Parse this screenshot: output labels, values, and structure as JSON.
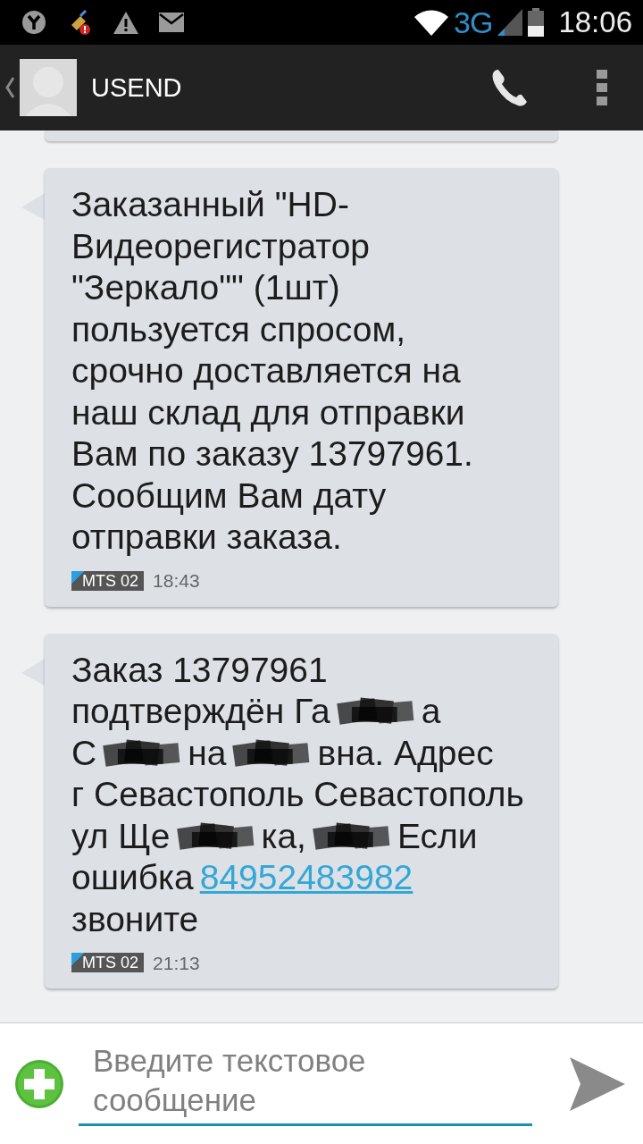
{
  "status_bar": {
    "network": "3G",
    "time": "18:06"
  },
  "action_bar": {
    "contact": "USEND"
  },
  "messages": [
    {
      "text": "Заказанный \"HD-Видеорегистратор \"Зеркало\"\" (1шт) пользуется спросом, срочно доставляется на наш склад для отправки Вам по заказу 13797961. Сообщим Вам дату отправки заказа.",
      "sim": "MTS 02",
      "time": "18:43"
    },
    {
      "lines": [
        [
          {
            "kind": "text",
            "text": "Заказ 13797961"
          }
        ],
        [
          {
            "kind": "text",
            "text": "подтверждён Га"
          },
          {
            "kind": "redacted"
          },
          {
            "kind": "text",
            "text": "а"
          }
        ],
        [
          {
            "kind": "text",
            "text": "С"
          },
          {
            "kind": "redacted"
          },
          {
            "kind": "text",
            "text": "на"
          },
          {
            "kind": "redacted"
          },
          {
            "kind": "text",
            "text": "вна. Адрес"
          }
        ],
        [
          {
            "kind": "text",
            "text": "г Севастополь Севастополь"
          }
        ],
        [
          {
            "kind": "text",
            "text": "ул Ще"
          },
          {
            "kind": "redacted"
          },
          {
            "kind": "text",
            "text": "ка,"
          },
          {
            "kind": "redacted"
          },
          {
            "kind": "text",
            "text": "Если"
          }
        ],
        [
          {
            "kind": "text",
            "text": "ошибка"
          },
          {
            "kind": "link",
            "text": "84952483982"
          }
        ],
        [
          {
            "kind": "text",
            "text": "звоните"
          }
        ]
      ],
      "sim": "MTS 02",
      "time": "21:13"
    }
  ],
  "composer": {
    "placeholder": "Введите текстовое сообщение"
  }
}
